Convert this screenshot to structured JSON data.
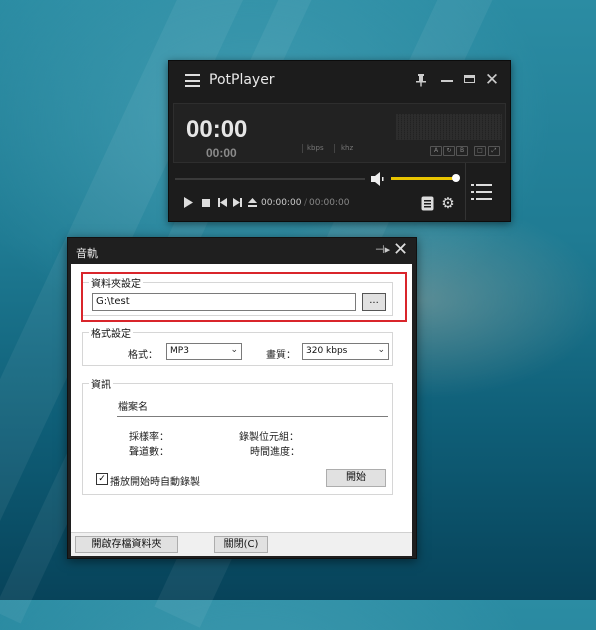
{
  "player": {
    "app_name": "PotPlayer",
    "time_main": "00:00",
    "time_sub": "00:00",
    "kbps_label": "kbps",
    "khz_label": "khz",
    "mini_labels": [
      "A",
      "↻",
      "B",
      "□",
      "⤢"
    ],
    "position": "00:00:00",
    "separator": "/",
    "duration": "00:00:00",
    "volume_fraction": 0.85,
    "accent_color": "#e8c400"
  },
  "dialog": {
    "title": "音軌",
    "folder_group": "資料夾設定",
    "folder_path": "G:\\test",
    "browse_label": "...",
    "format_group": "格式設定",
    "format_label": "格式：",
    "format_value": "MP3",
    "quality_label": "畫質：",
    "quality_value": "320 kbps",
    "info_group": "資訊",
    "filename_label": "檔案名",
    "sample_rate_label": "採樣率：",
    "bit_label": "錄製位元組：",
    "channels_label": "聲道數：",
    "progress_label": "時間進度：",
    "auto_record_label": "播放開始時自動錄製",
    "auto_record_checked": true,
    "start_button": "開始",
    "open_folder_button": "開啟存檔資料夾",
    "close_button": "關閉(C)"
  },
  "highlight_color": "#d9252b"
}
